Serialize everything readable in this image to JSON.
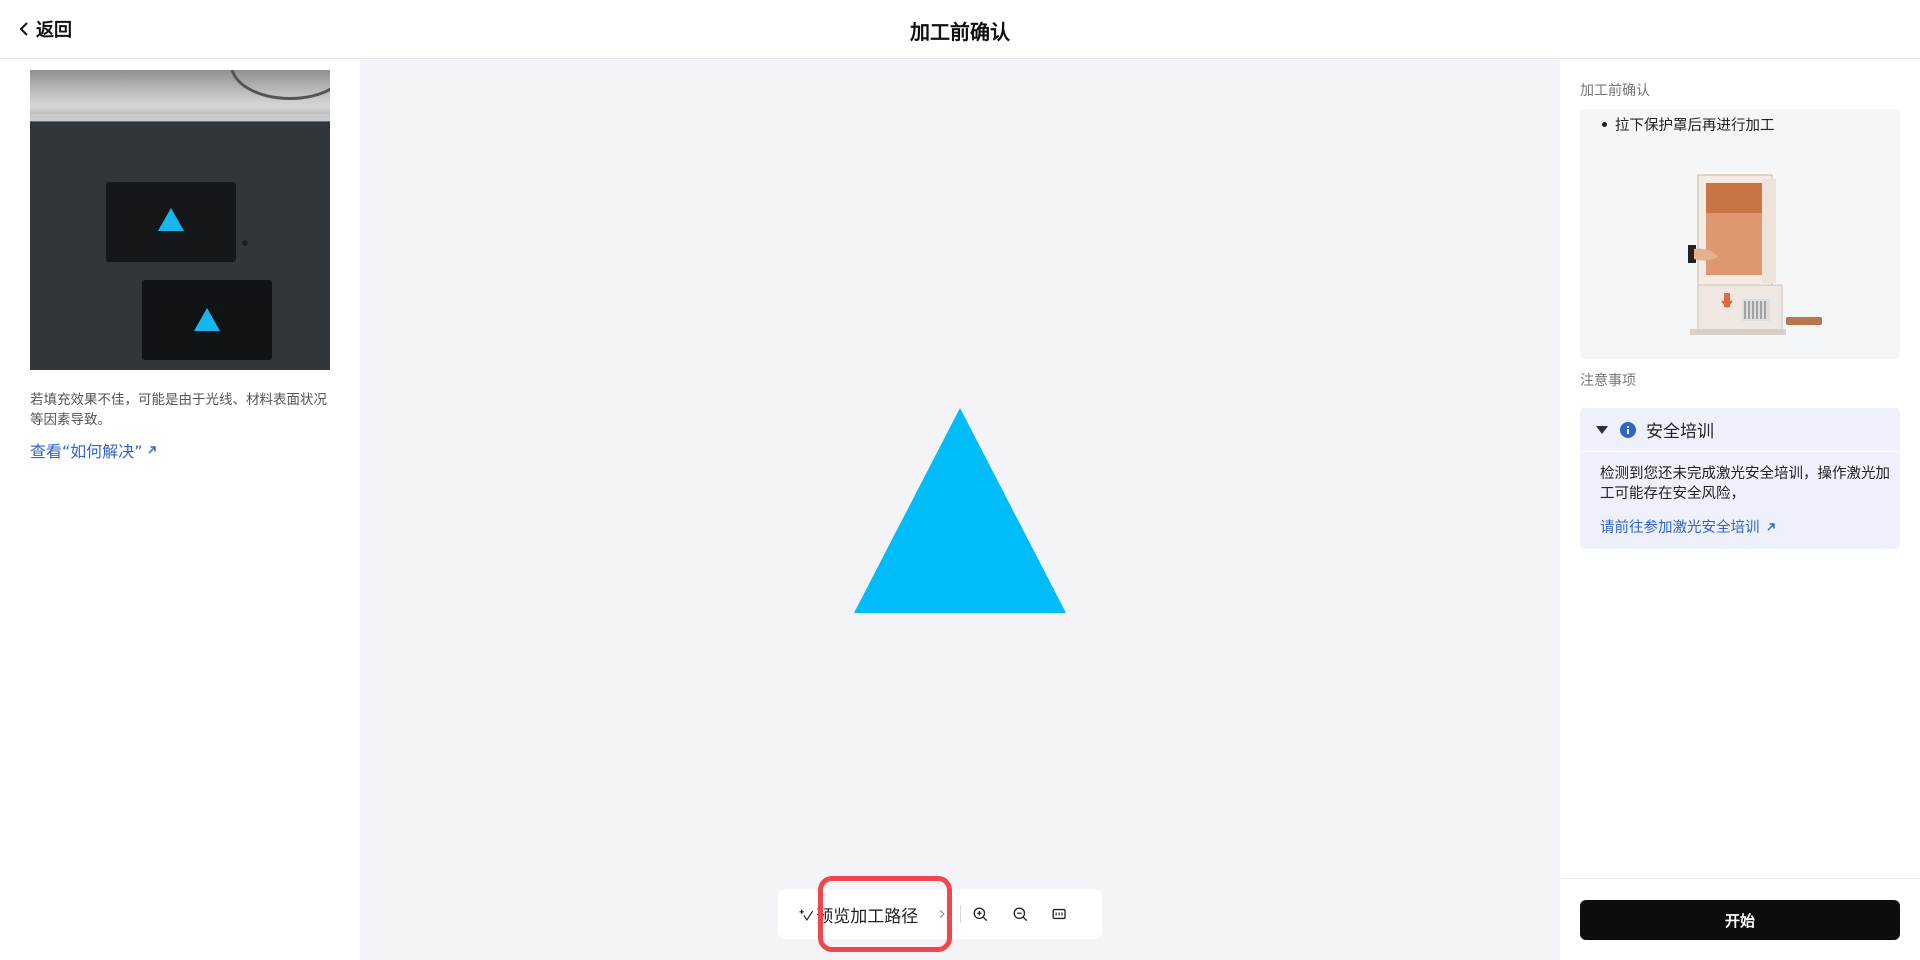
{
  "header": {
    "back_label": "返回",
    "title": "加工前确认"
  },
  "left": {
    "hint_text": "若填充效果不佳，可能是由于光线、材料表面状况等因素导致。",
    "hint_link": "查看“如何解决”"
  },
  "canvas": {
    "shape": "triangle",
    "shape_color": "#00BCF8",
    "toolbar": {
      "preview_label": "预览加工路径",
      "icons": [
        "path-preview-icon",
        "chevron-right-icon",
        "zoom-in-icon",
        "zoom-out-icon",
        "fit-screen-icon"
      ]
    }
  },
  "right": {
    "confirm_label": "加工前确认",
    "confirm_items": [
      "拉下保护罩后再进行加工"
    ],
    "notes_label": "注意事项",
    "notice": {
      "title": "安全培训",
      "body": "检测到您还未完成激光安全培训，操作激光加工可能存在安全风险，",
      "link": "请前往参加激光安全培训"
    },
    "start_label": "开始"
  },
  "colors": {
    "accent_link": "#2F64C8",
    "highlight": "#F0464D",
    "start_button": "#0C0D10",
    "canvas_bg": "#F4F4F8"
  }
}
